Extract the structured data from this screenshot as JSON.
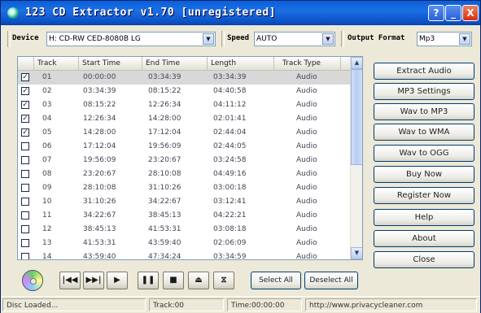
{
  "window": {
    "title": "123 CD Extractor v1.70 [unregistered]",
    "controls": {
      "help": "?",
      "minimize": "_",
      "close": "X"
    }
  },
  "toolbar": {
    "device_label": "Device",
    "device_value": "H: CD-RW CED-8080B LG",
    "speed_label": "Speed",
    "speed_value": "AUTO",
    "format_label": "Output Format",
    "format_value": "Mp3"
  },
  "tracklist": {
    "columns": [
      "Track",
      "Start Time",
      "End Time",
      "Length",
      "Track Type"
    ],
    "rows": [
      {
        "checked": true,
        "track": "01",
        "start": "00:00:00",
        "end": "03:34:39",
        "length": "03:34:39",
        "type": "Audio"
      },
      {
        "checked": true,
        "track": "02",
        "start": "03:34:39",
        "end": "08:15:22",
        "length": "04:40:58",
        "type": "Audio"
      },
      {
        "checked": true,
        "track": "03",
        "start": "08:15:22",
        "end": "12:26:34",
        "length": "04:11:12",
        "type": "Audio"
      },
      {
        "checked": true,
        "track": "04",
        "start": "12:26:34",
        "end": "14:28:00",
        "length": "02:01:41",
        "type": "Audio"
      },
      {
        "checked": true,
        "track": "05",
        "start": "14:28:00",
        "end": "17:12:04",
        "length": "02:44:04",
        "type": "Audio"
      },
      {
        "checked": false,
        "track": "06",
        "start": "17:12:04",
        "end": "19:56:09",
        "length": "02:44:05",
        "type": "Audio"
      },
      {
        "checked": false,
        "track": "07",
        "start": "19:56:09",
        "end": "23:20:67",
        "length": "03:24:58",
        "type": "Audio"
      },
      {
        "checked": false,
        "track": "08",
        "start": "23:20:67",
        "end": "28:10:08",
        "length": "04:49:16",
        "type": "Audio"
      },
      {
        "checked": false,
        "track": "09",
        "start": "28:10:08",
        "end": "31:10:26",
        "length": "03:00:18",
        "type": "Audio"
      },
      {
        "checked": false,
        "track": "10",
        "start": "31:10:26",
        "end": "34:22:67",
        "length": "03:12:41",
        "type": "Audio"
      },
      {
        "checked": false,
        "track": "11",
        "start": "34:22:67",
        "end": "38:45:13",
        "length": "04:22:21",
        "type": "Audio"
      },
      {
        "checked": false,
        "track": "12",
        "start": "38:45:13",
        "end": "41:53:31",
        "length": "03:08:18",
        "type": "Audio"
      },
      {
        "checked": false,
        "track": "13",
        "start": "41:53:31",
        "end": "43:59:40",
        "length": "02:06:09",
        "type": "Audio"
      },
      {
        "checked": false,
        "track": "14",
        "start": "43:59:40",
        "end": "47:34:24",
        "length": "03:34:59",
        "type": "Audio"
      }
    ]
  },
  "actions": {
    "extract_audio": "Extract Audio",
    "mp3_settings": "MP3 Settings",
    "wav_to_mp3": "Wav to MP3",
    "wav_to_wma": "Wav to WMA",
    "wav_to_ogg": "Wav to OGG",
    "buy_now": "Buy Now",
    "register_now": "Register Now",
    "help": "Help",
    "about": "About",
    "close": "Close"
  },
  "player": {
    "select_all": "Select All",
    "deselect_all": "Deselect All"
  },
  "status": {
    "message": "Disc Loaded...",
    "track": "Track:00",
    "time": "Time:00:00:00",
    "url": "http://www.privacycleaner.com"
  }
}
